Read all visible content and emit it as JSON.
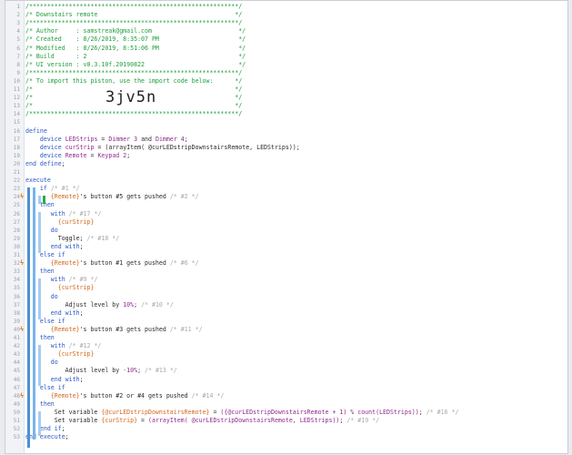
{
  "lines": [
    {
      "n": "1",
      "parts": [
        [
          "c",
          "/**********************************************************/"
        ]
      ]
    },
    {
      "n": "2",
      "parts": [
        [
          "c",
          "/* Downstairs remote                                      */"
        ]
      ]
    },
    {
      "n": "3",
      "parts": [
        [
          "c",
          "/**********************************************************/"
        ]
      ]
    },
    {
      "n": "4",
      "parts": [
        [
          "c",
          "/* Author     : samstreak@gmail.com                        */"
        ]
      ]
    },
    {
      "n": "5",
      "parts": [
        [
          "c",
          "/* Created    : 8/26/2019, 8:35:07 PM                      */"
        ]
      ]
    },
    {
      "n": "6",
      "parts": [
        [
          "c",
          "/* Modified   : 8/26/2019, 8:51:06 PM                      */"
        ]
      ]
    },
    {
      "n": "7",
      "parts": [
        [
          "c",
          "/* Build      : 2                                          */"
        ]
      ]
    },
    {
      "n": "8",
      "parts": [
        [
          "c",
          "/* UI version : v0.3.10f.20190822                          */"
        ]
      ]
    },
    {
      "n": "9",
      "parts": [
        [
          "c",
          "/**********************************************************/"
        ]
      ]
    },
    {
      "n": "10",
      "parts": [
        [
          "c",
          "/* To import this piston, use the import code below:      */"
        ]
      ]
    },
    {
      "n": "11",
      "parts": [
        [
          "c",
          "/*                                                        */"
        ]
      ]
    },
    {
      "n": "12",
      "parts": [
        [
          "c",
          "/*                                                        */"
        ]
      ]
    },
    {
      "n": "13",
      "parts": [
        [
          "c",
          "/*                                                        */"
        ]
      ]
    },
    {
      "n": "14",
      "parts": [
        [
          "c",
          "/**********************************************************/"
        ]
      ]
    },
    {
      "n": "15",
      "parts": []
    },
    {
      "n": "16",
      "parts": [
        [
          "k",
          "define"
        ]
      ]
    },
    {
      "n": "17",
      "parts": [
        [
          "t",
          "    "
        ],
        [
          "k",
          "device "
        ],
        [
          "d",
          "LEDStrips"
        ],
        [
          "t",
          " = "
        ],
        [
          "d",
          "Dimmer 3"
        ],
        [
          "t",
          " and "
        ],
        [
          "d",
          "Dimmer 4"
        ],
        [
          "t",
          ";"
        ]
      ]
    },
    {
      "n": "18",
      "parts": [
        [
          "t",
          "    "
        ],
        [
          "k",
          "device "
        ],
        [
          "d",
          "curStrip"
        ],
        [
          "t",
          " = "
        ],
        [
          "t",
          "(arrayItem( @curLEDstripDownstairsRemote, LEDStrips));"
        ]
      ]
    },
    {
      "n": "19",
      "parts": [
        [
          "t",
          "    "
        ],
        [
          "k",
          "device "
        ],
        [
          "d",
          "Remote"
        ],
        [
          "t",
          " = "
        ],
        [
          "d",
          "Keypad 2"
        ],
        [
          "t",
          ";"
        ]
      ]
    },
    {
      "n": "20",
      "parts": [
        [
          "k",
          "end define"
        ],
        [
          "t",
          ";"
        ]
      ]
    },
    {
      "n": "21",
      "parts": []
    },
    {
      "n": "22",
      "parts": [
        [
          "k",
          "execute"
        ]
      ]
    },
    {
      "n": "23",
      "parts": [
        [
          "t",
          "    "
        ],
        [
          "k",
          "if"
        ],
        [
          "cm",
          " /* #1 */"
        ]
      ]
    },
    {
      "n": "24",
      "parts": [
        [
          "t",
          "       "
        ],
        [
          "v",
          "{Remote}"
        ],
        [
          "t",
          "'s button "
        ],
        [
          "t",
          "#5"
        ],
        [
          "t",
          " gets "
        ],
        [
          "t",
          "pushed"
        ],
        [
          "cm",
          " /* #2 */"
        ]
      ]
    },
    {
      "n": "25",
      "parts": [
        [
          "t",
          "    "
        ],
        [
          "k",
          "then"
        ]
      ]
    },
    {
      "n": "26",
      "parts": [
        [
          "t",
          "       "
        ],
        [
          "k",
          "with"
        ],
        [
          "cm",
          " /* #17 */"
        ]
      ]
    },
    {
      "n": "27",
      "parts": [
        [
          "t",
          "         "
        ],
        [
          "v",
          "{curStrip}"
        ]
      ]
    },
    {
      "n": "28",
      "parts": [
        [
          "t",
          "       "
        ],
        [
          "k",
          "do"
        ]
      ]
    },
    {
      "n": "29",
      "parts": [
        [
          "t",
          "         Toggle;"
        ],
        [
          "cm",
          " /* #18 */"
        ]
      ]
    },
    {
      "n": "30",
      "parts": [
        [
          "t",
          "       "
        ],
        [
          "k",
          "end with"
        ],
        [
          "t",
          ";"
        ]
      ]
    },
    {
      "n": "31",
      "parts": [
        [
          "t",
          "    "
        ],
        [
          "k",
          "else if"
        ]
      ]
    },
    {
      "n": "32",
      "parts": [
        [
          "t",
          "       "
        ],
        [
          "v",
          "{Remote}"
        ],
        [
          "t",
          "'s button #1 gets pushed"
        ],
        [
          "cm",
          " /* #6 */"
        ]
      ]
    },
    {
      "n": "33",
      "parts": [
        [
          "t",
          "    "
        ],
        [
          "k",
          "then"
        ]
      ]
    },
    {
      "n": "34",
      "parts": [
        [
          "t",
          "       "
        ],
        [
          "k",
          "with"
        ],
        [
          "cm",
          " /* #9 */"
        ]
      ]
    },
    {
      "n": "35",
      "parts": [
        [
          "t",
          "         "
        ],
        [
          "v",
          "{curStrip}"
        ]
      ]
    },
    {
      "n": "36",
      "parts": [
        [
          "t",
          "       "
        ],
        [
          "k",
          "do"
        ]
      ]
    },
    {
      "n": "37",
      "parts": [
        [
          "t",
          "           Adjust level by "
        ],
        [
          "d",
          "10%"
        ],
        [
          "t",
          ";"
        ],
        [
          "cm",
          " /* #10 */"
        ]
      ]
    },
    {
      "n": "38",
      "parts": [
        [
          "t",
          "       "
        ],
        [
          "k",
          "end with"
        ],
        [
          "t",
          ";"
        ]
      ]
    },
    {
      "n": "39",
      "parts": [
        [
          "t",
          "    "
        ],
        [
          "k",
          "else if"
        ]
      ]
    },
    {
      "n": "40",
      "parts": [
        [
          "t",
          "       "
        ],
        [
          "v",
          "{Remote}"
        ],
        [
          "t",
          "'s button #3 gets pushed"
        ],
        [
          "cm",
          " /* #11 */"
        ]
      ]
    },
    {
      "n": "41",
      "parts": [
        [
          "t",
          "    "
        ],
        [
          "k",
          "then"
        ]
      ]
    },
    {
      "n": "42",
      "parts": [
        [
          "t",
          "       "
        ],
        [
          "k",
          "with"
        ],
        [
          "cm",
          " /* #12 */"
        ]
      ]
    },
    {
      "n": "43",
      "parts": [
        [
          "t",
          "         "
        ],
        [
          "v",
          "{curStrip}"
        ]
      ]
    },
    {
      "n": "44",
      "parts": [
        [
          "t",
          "       "
        ],
        [
          "k",
          "do"
        ]
      ]
    },
    {
      "n": "45",
      "parts": [
        [
          "t",
          "           Adjust level by "
        ],
        [
          "d",
          "-10%"
        ],
        [
          "t",
          ";"
        ],
        [
          "cm",
          " /* #13 */"
        ]
      ]
    },
    {
      "n": "46",
      "parts": [
        [
          "t",
          "       "
        ],
        [
          "k",
          "end with"
        ],
        [
          "t",
          ";"
        ]
      ]
    },
    {
      "n": "47",
      "parts": [
        [
          "t",
          "    "
        ],
        [
          "k",
          "else if"
        ]
      ]
    },
    {
      "n": "48",
      "parts": [
        [
          "t",
          "       "
        ],
        [
          "v",
          "{Remote}"
        ],
        [
          "t",
          "'s button #2 or #4 gets pushed"
        ],
        [
          "cm",
          " /* #14 */"
        ]
      ]
    },
    {
      "n": "49",
      "parts": [
        [
          "t",
          "    "
        ],
        [
          "k",
          "then"
        ]
      ]
    },
    {
      "n": "50",
      "parts": [
        [
          "t",
          "        Set variable "
        ],
        [
          "v",
          "{@curLEDstripDownstairsRemote}"
        ],
        [
          "t",
          " = "
        ],
        [
          "d",
          "({@curLEDstripDownstairsRemote + 1) % count(LEDStrips))"
        ],
        [
          "t",
          ";"
        ],
        [
          "cm",
          " /* #16 */"
        ]
      ]
    },
    {
      "n": "51",
      "parts": [
        [
          "t",
          "        Set variable "
        ],
        [
          "v",
          "{curStrip}"
        ],
        [
          "t",
          " = "
        ],
        [
          "d",
          "(arrayItem( @curLEDstripDownstairsRemote, LEDStrips))"
        ],
        [
          "t",
          ";"
        ],
        [
          "cm",
          " /* #19 */"
        ]
      ]
    },
    {
      "n": "52",
      "parts": [
        [
          "t",
          "    "
        ],
        [
          "k",
          "end if"
        ],
        [
          "t",
          ";"
        ]
      ]
    },
    {
      "n": "53",
      "parts": [
        [
          "k",
          "end execute"
        ],
        [
          "t",
          ";"
        ]
      ]
    }
  ],
  "import_code": "3jv5n",
  "markers": {
    "24": "ϟ",
    "32": "ϟ",
    "40": "ϟ",
    "48": "ϟ"
  },
  "colors": {
    "comment": "#1f9e3a",
    "keyword": "#2a56c6",
    "variable": "#d2691e",
    "device": "#8f2b8f",
    "marker": "#e8761a"
  }
}
